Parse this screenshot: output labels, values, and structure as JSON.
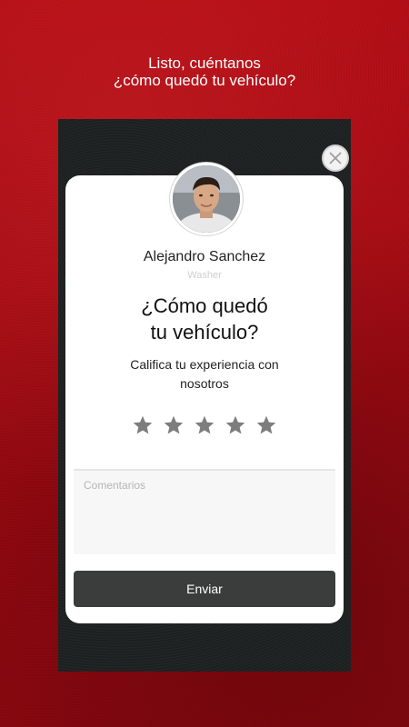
{
  "header": {
    "line1": "Listo, cuéntanos",
    "line2": "¿cómo quedó tu vehículo?"
  },
  "washer": {
    "name": "Alejandro Sanchez",
    "role": "Washer"
  },
  "rating": {
    "title_line1": "¿Cómo quedó",
    "title_line2": "tu vehículo?",
    "subtitle_line1": "Califica tu experiencia con",
    "subtitle_line2": "nosotros",
    "max_stars": 5,
    "selected_stars": 0,
    "star_color": "#7d7d7d"
  },
  "comments": {
    "placeholder": "Comentarios",
    "value": ""
  },
  "submit": {
    "label": "Enviar"
  },
  "colors": {
    "background": "#a10a12",
    "panel": "#1d2020",
    "button": "#3b3c3c"
  },
  "icons": {
    "close": "close-icon",
    "star": "star-icon",
    "avatar": "avatar"
  }
}
